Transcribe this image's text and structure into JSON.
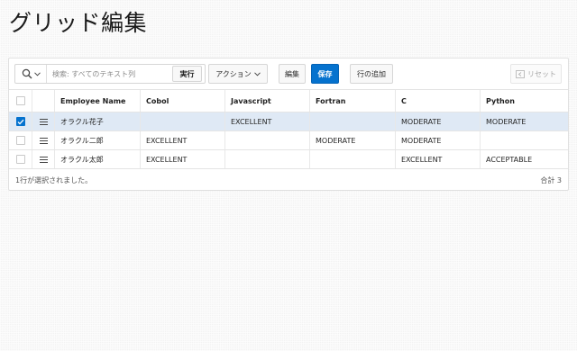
{
  "page": {
    "title": "グリッド編集"
  },
  "toolbar": {
    "search_placeholder": "検索: すべてのテキスト列",
    "go_label": "実行",
    "actions_label": "アクション",
    "edit_label": "編集",
    "save_label": "保存",
    "add_row_label": "行の追加",
    "reset_label": "リセット"
  },
  "grid": {
    "columns": [
      "Employee Name",
      "Cobol",
      "Javascript",
      "Fortran",
      "C",
      "Python"
    ],
    "rows": [
      {
        "selected": true,
        "cells": [
          "オラクル花子",
          "",
          "EXCELLENT",
          "",
          "MODERATE",
          "MODERATE"
        ]
      },
      {
        "selected": false,
        "cells": [
          "オラクル二郎",
          "EXCELLENT",
          "",
          "MODERATE",
          "MODERATE",
          ""
        ]
      },
      {
        "selected": false,
        "cells": [
          "オラクル太郎",
          "EXCELLENT",
          "",
          "",
          "EXCELLENT",
          "ACCEPTABLE"
        ]
      }
    ]
  },
  "footer": {
    "selection_status": "1行が選択されました。",
    "total": "合計 3"
  },
  "colors": {
    "accent": "#0572ce",
    "selected_row": "#dfe9f5"
  }
}
